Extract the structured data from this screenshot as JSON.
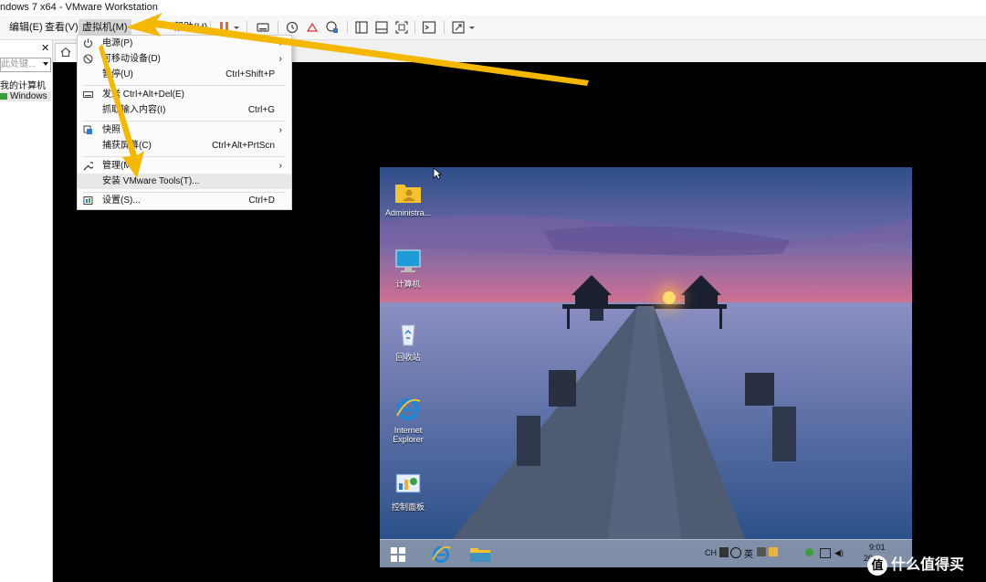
{
  "window": {
    "title": "ndows 7 x64 - VMware Workstation"
  },
  "menubar": {
    "items": [
      {
        "label": "编辑(E)"
      },
      {
        "label": "查看(V)"
      },
      {
        "label": "虚拟机(M)"
      },
      {
        "label": "帮助(H)"
      }
    ],
    "toolbar_icons": [
      "pause-icon",
      "send-keys-icon",
      "snapshot-icon",
      "revert-snapshot-icon",
      "manage-snapshots-icon",
      "library-view-icon",
      "thumbnail-view-icon",
      "fullscreen-icon",
      "console-icon",
      "stretch-icon"
    ]
  },
  "library": {
    "search_placeholder": "此处键...",
    "items": [
      {
        "label": "我的计算机"
      },
      {
        "label": "Windows"
      }
    ]
  },
  "vm_menu": {
    "items": [
      {
        "label": "电源(P)",
        "shortcut": "",
        "submenu": true,
        "icon": "power-icon"
      },
      {
        "label": "可移动设备(D)",
        "shortcut": "",
        "submenu": true,
        "icon": "removable-device-icon"
      },
      {
        "label": "暂停(U)",
        "shortcut": "Ctrl+Shift+P",
        "submenu": false,
        "icon": ""
      },
      {
        "label": "发送 Ctrl+Alt+Del(E)",
        "shortcut": "",
        "submenu": false,
        "icon": "keyboard-icon"
      },
      {
        "label": "抓取输入内容(I)",
        "shortcut": "Ctrl+G",
        "submenu": false,
        "icon": ""
      },
      {
        "label": "快照",
        "shortcut": "",
        "submenu": true,
        "icon": "snapshot-icon"
      },
      {
        "label": "捕获屏幕(C)",
        "shortcut": "Ctrl+Alt+PrtScn",
        "submenu": false,
        "icon": ""
      },
      {
        "label": "管理(M)",
        "shortcut": "",
        "submenu": true,
        "icon": "wrench-icon"
      },
      {
        "label": "安装 VMware Tools(T)...",
        "shortcut": "",
        "submenu": false,
        "icon": ""
      },
      {
        "label": "设置(S)...",
        "shortcut": "Ctrl+D",
        "submenu": false,
        "icon": "settings-icon"
      }
    ]
  },
  "guest": {
    "desktop_icons": [
      {
        "label": "Administra...",
        "icon": "user-folder-icon"
      },
      {
        "label": "计算机",
        "icon": "computer-icon"
      },
      {
        "label": "回收站",
        "icon": "recycle-bin-icon"
      },
      {
        "label": "Internet Explorer",
        "icon": "ie-icon"
      },
      {
        "label": "控制面板",
        "icon": "control-panel-icon"
      }
    ],
    "tray": {
      "lang": "CH",
      "ime": "英",
      "time": "9:01",
      "date": "20"
    }
  },
  "watermark": {
    "text": "什么值得买",
    "logo": "值"
  },
  "colors": {
    "accent_arrow": "#f5b800",
    "pause": "#e8692a"
  }
}
